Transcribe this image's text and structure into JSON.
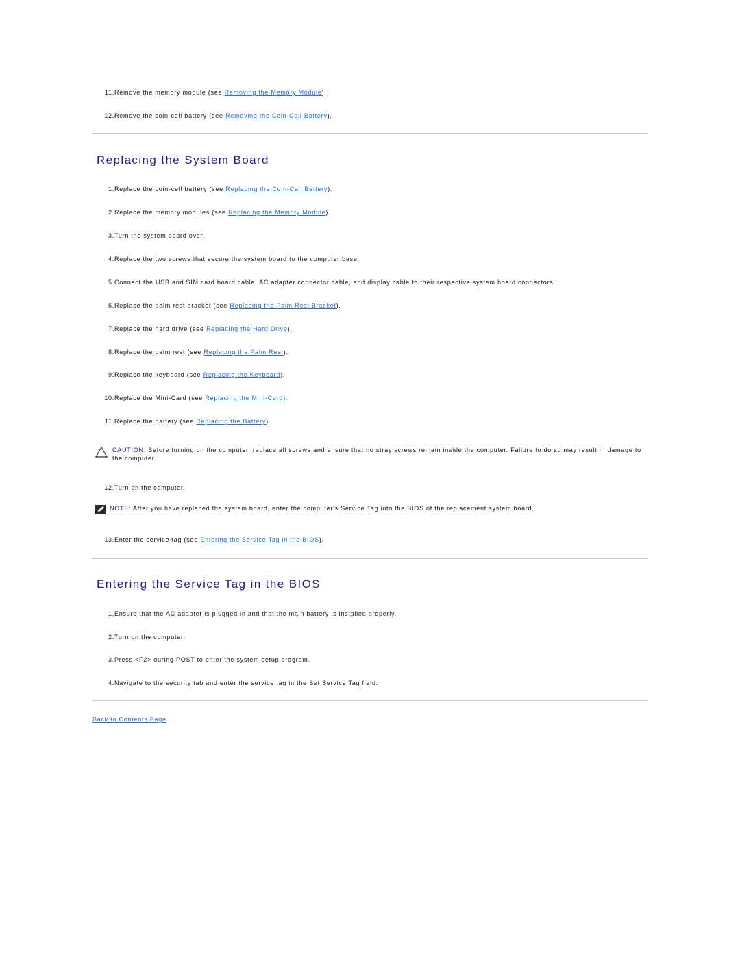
{
  "top_steps": [
    {
      "num": "11.",
      "pre": "Remove the memory module (see ",
      "link": "Removing the Memory Module",
      "post": ")."
    },
    {
      "num": "12.",
      "pre": "Remove the coin-cell battery (see ",
      "link": "Removing the Coin-Cell Battery",
      "post": ")."
    }
  ],
  "section1": {
    "title": "Replacing the System Board",
    "steps": [
      {
        "num": "1.",
        "pre": "Replace the coin-cell battery (see ",
        "link": "Replacing the Coin-Cell Battery",
        "post": ")."
      },
      {
        "num": "2.",
        "pre": "Replace the memory modules (see ",
        "link": "Replacing the Memory Module",
        "post": ")."
      },
      {
        "num": "3.",
        "pre": "Turn the system board over.",
        "link": null,
        "post": ""
      },
      {
        "num": "4.",
        "pre": "Replace the two screws that secure the system board to the computer base.",
        "link": null,
        "post": ""
      },
      {
        "num": "5.",
        "pre": "Connect the USB and SIM card board cable, AC adapter connector cable, and display cable to their respective system board connectors.",
        "link": null,
        "post": ""
      },
      {
        "num": "6.",
        "pre": "Replace the palm rest bracket (see ",
        "link": "Replacing the Palm Rest Bracket",
        "post": ")."
      },
      {
        "num": "7.",
        "pre": "Replace the hard drive (see ",
        "link": "Replacing the Hard Drive",
        "post": ")."
      },
      {
        "num": "8.",
        "pre": "Replace the palm rest (see ",
        "link": "Replacing the Palm Rest",
        "post": ")."
      },
      {
        "num": "9.",
        "pre": "Replace the keyboard (see ",
        "link": "Replacing the Keyboard",
        "post": ")."
      },
      {
        "num": "10.",
        "pre": "Replace the Mini-Card (see ",
        "link": "Replacing the Mini-Card",
        "post": ")."
      },
      {
        "num": "11.",
        "pre": "Replace the battery (see ",
        "link": "Replacing the Battery",
        "post": ")."
      }
    ],
    "caution": {
      "icon": "caution-triangle-icon",
      "label": "CAUTION:",
      "text": " Before turning on the computer, replace all screws and ensure that no stray screws remain inside the computer. Failure to do so may result in damage to the computer."
    },
    "step12": {
      "num": "12.",
      "pre": "Turn on the computer.",
      "link": null,
      "post": ""
    },
    "note": {
      "icon": "note-pencil-icon",
      "label": "NOTE:",
      "text": " After you have replaced the system board, enter the computer's Service Tag into the BIOS of the replacement system board."
    },
    "step13": {
      "num": "13.",
      "pre": "Enter the service tag (see ",
      "link": "Entering the Service Tag in the BIOS",
      "post": ")."
    }
  },
  "section2": {
    "title": "Entering the Service Tag in the BIOS",
    "steps": [
      {
        "num": "1.",
        "pre": "Ensure that the AC adapter is plugged in and that the main battery is installed properly.",
        "link": null,
        "post": ""
      },
      {
        "num": "2.",
        "pre": "Turn on the computer.",
        "link": null,
        "post": ""
      },
      {
        "num": "3.",
        "pre": "Press <F2> during POST to enter the system setup program.",
        "link": null,
        "post": ""
      },
      {
        "num": "4.",
        "pre": "Navigate to the security tab and enter the service tag in the Set Service Tag field.",
        "link": null,
        "post": ""
      }
    ]
  },
  "footer": {
    "back_link": "Back to Contents Page"
  },
  "colors": {
    "heading": "#1e1e8c",
    "link": "#2a6fd6",
    "rule": "#c8c8c8"
  }
}
